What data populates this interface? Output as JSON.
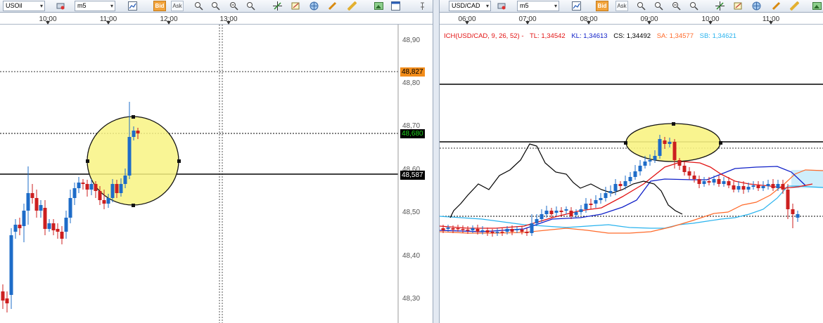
{
  "left_chart": {
    "symbol": "USOil",
    "timeframe": "m5",
    "bid_label": "Bid",
    "ask_label": "Ask",
    "time_labels": [
      "10:00",
      "11:00",
      "12:00",
      "13:00"
    ],
    "price_labels": [
      "48,90",
      "48,80",
      "48,70",
      "48,60",
      "48,50",
      "48,40",
      "48,30"
    ],
    "price_tags": {
      "orange": "48,827",
      "green": "48,680",
      "black": "48,587"
    },
    "colors": {
      "tag_orange": "#f28c1a",
      "tag_green": "#1fd31f",
      "tag_black": "#000000",
      "bull": "#1e6cc8",
      "bear": "#cc1f1f",
      "highlight": "#f8f383"
    }
  },
  "right_chart": {
    "symbol": "USD/CAD",
    "timeframe": "m5",
    "bid_label": "Bid",
    "ask_label": "Ask",
    "time_labels": [
      "06:00",
      "07:00",
      "08:00",
      "09:00",
      "10:00",
      "11:00"
    ],
    "ichimoku": {
      "name": "ICH(USD/CAD, 9, 26, 52) -",
      "tl": "TL: 1,34542",
      "kl": "KL: 1,34613",
      "cs": "CS: 1,34492",
      "sa": "SA: 1,34577",
      "sb": "SB: 1,34621"
    },
    "colors": {
      "tl": "#e21414",
      "kl": "#1020c8",
      "cs": "#000000",
      "sa": "#ff6a2a",
      "sb": "#29b3ee",
      "bull": "#1e6cc8",
      "bear": "#cc1f1f",
      "highlight": "#f8f383"
    }
  }
}
